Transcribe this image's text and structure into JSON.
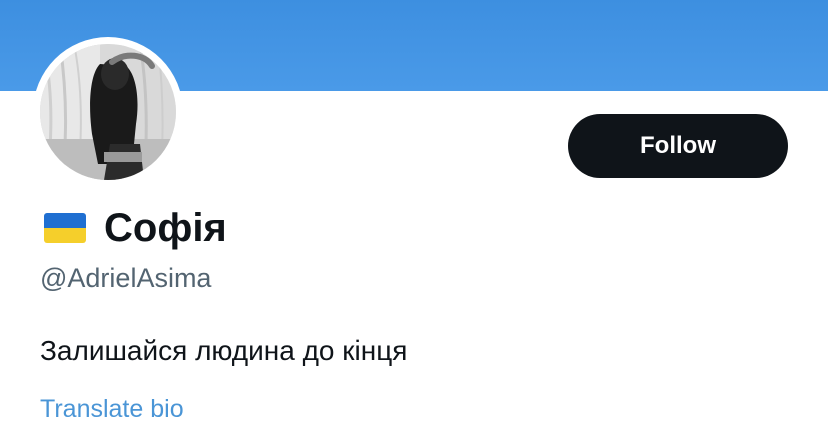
{
  "profile": {
    "display_name": "Софія",
    "handle": "@AdrielAsima",
    "bio": "Залишайся людина до кінця",
    "flag_icon": "ukraine-flag-icon"
  },
  "actions": {
    "follow_label": "Follow",
    "translate_bio_label": "Translate bio"
  },
  "colors": {
    "banner": "#4a9ae8",
    "follow_button_bg": "#0f1419",
    "handle_text": "#536471",
    "link": "#4a95d6"
  }
}
